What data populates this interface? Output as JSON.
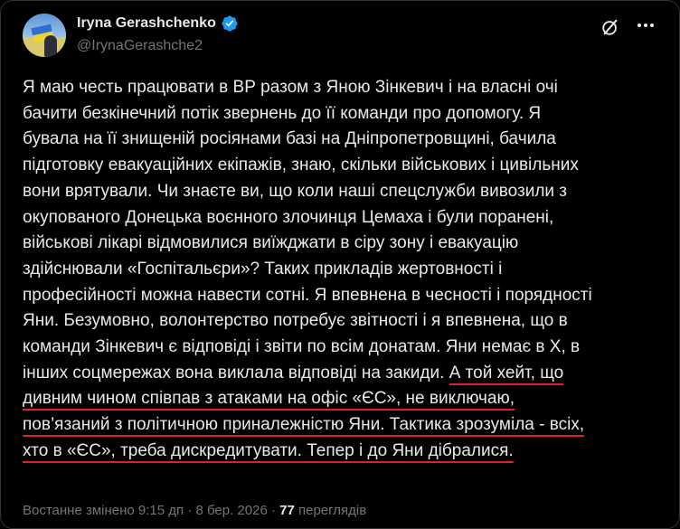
{
  "author": {
    "name": "Iryna Gerashchenko",
    "handle": "@IrynaGerashche2",
    "verified": true
  },
  "icons": {
    "avatar": "profile-photo-with-ukrainian-flag",
    "verified": "verified-badge-icon",
    "grok": "grok-icon",
    "more": "more-options-icon",
    "verified_color": "#1d9bf0"
  },
  "post": {
    "text_plain": "Я маю честь працювати в ВР разом з Яною Зінкевич і на власні очі\nбачити  безкінечний потік звернень до її команди про допомогу. Я\nбувала на її знищеній росіянами базі на Дніпропетровщині, бачила\nпідготовку евакуаційних екіпажів, знаю, скільки військових і цивільних\nвони врятували. Чи знаєте ви, що коли наші спецслужби вивозили з\nокупованого Донецька воєнного злочинця Цемаха і були поранені,\nвійськові лікарі відмовилися виїжджати в сіру зону і евакуацію\nздійснювали «Госпітальєри»? Таких прикладів жертовності і\nпрофесійності можна навести сотні. Я впевнена в чесності і порядності\nЯни. Безумовно, волонтерство потребує звітності і я впевнена, що в\nкоманди Зінкевич є відповіді і звіти по всім донатам.  Яни немає в Х, в\nінших соцмережах вона виклала  відповіді на закиди. ",
    "text_highlight": "А той хейт, що\nдивним чином співпав з атаками на офіс «ЄС», не виключаю,\nпов’язаний  з політичною приналежністю Яни. Тактика зрозуміла - всіх,\nхто в «ЄС», треба дискредитувати. Тепер і до Яни дібралися.",
    "highlight_color": "#e0202a"
  },
  "meta": {
    "edited": "Востанне змінено 9:15 дп · 8 бер. 2026 · ",
    "views_count": "77",
    "views_label": " переглядів"
  }
}
